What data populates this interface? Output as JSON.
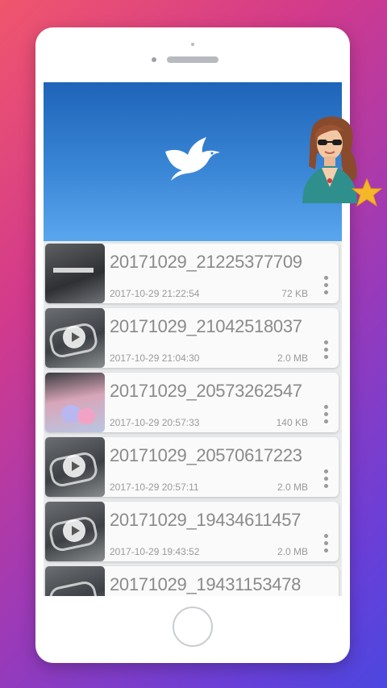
{
  "files": [
    {
      "name": "20171029_21225377709",
      "date": "2017-10-29 21:22:54",
      "size": "72 KB"
    },
    {
      "name": "20171029_21042518037",
      "date": "2017-10-29 21:04:30",
      "size": "2.0 MB"
    },
    {
      "name": "20171029_20573262547",
      "date": "2017-10-29 20:57:33",
      "size": "140 KB"
    },
    {
      "name": "20171029_20570617223",
      "date": "2017-10-29 20:57:11",
      "size": "2.0 MB"
    },
    {
      "name": "20171029_19434611457",
      "date": "2017-10-29 19:43:52",
      "size": "2.0 MB"
    },
    {
      "name": "20171029_19431153478",
      "date": "",
      "size": ""
    }
  ],
  "icons": {
    "header_logo": "bird-icon",
    "overflow": "more-vertical-icon",
    "badge": "star-icon",
    "avatar": "woman-avatar-icon"
  },
  "colors": {
    "header_top": "#1e64b8",
    "header_bottom": "#5aa6ee",
    "text_muted": "#8a8a8a"
  }
}
